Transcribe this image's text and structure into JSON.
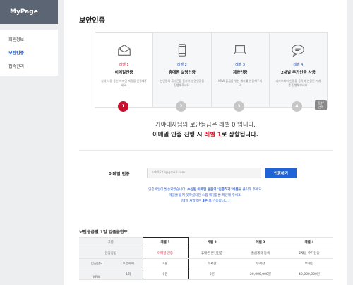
{
  "sidebar": {
    "title": "MyPage",
    "items": [
      {
        "label": "회원정보"
      },
      {
        "label": "보안인증"
      },
      {
        "label": "접속관리"
      }
    ]
  },
  "page": {
    "title": "보안인증"
  },
  "levels": [
    {
      "num": "레벨 1",
      "name": "이메일인증",
      "desc": "실제 사용 중인 이메일 계정을 인증해주세요.",
      "icon": "mail-icon"
    },
    {
      "num": "레벨 2",
      "name": "휴대폰 실명인증",
      "desc": "본인명의 휴대폰을 통하여 실명인증을 진행해주세요.",
      "icon": "phone-icon"
    },
    {
      "num": "레벨 3",
      "name": "계좌인증",
      "desc": "KRW 출금을 위한 계좌를 인증해주세요.",
      "icon": "laptop-icon"
    },
    {
      "num": "레벨 4",
      "name": "2채널 추가인증 사용",
      "desc": "카카오페이 인증을 통하여 인증된 거래를 진행해보세요.",
      "icon": "chat-icon",
      "badge": "필수/선택"
    }
  ],
  "steps": [
    "1",
    "2",
    "3",
    "4"
  ],
  "status": {
    "line1": "가야태자님의 보안등급은 레벨 0 입니다.",
    "line2_prefix": "이메일 인증 진행 시 ",
    "line2_level": "레벨 1",
    "line2_suffix": "로 상향됩니다."
  },
  "email": {
    "label": "이메일 인증",
    "value": "ssb0523@gmail.com",
    "button": "인증하기"
  },
  "notice": {
    "l1_a": "인증메일이 발송되었습니다. ",
    "l1_b": "수신된 이메일 본문의 '인증하기' 버튼",
    "l1_c": "을 클릭해 주세요.",
    "l2": "메일을 받지 못하셨다면 스팸 메일함을 확인해 주세요.",
    "l3_a": "(메일 재발송은 ",
    "l3_b": "3분 후",
    "l3_c": " 가능합니다.)"
  },
  "limits": {
    "title": "보안등급별 1일 입출금한도",
    "header": [
      "구분",
      "레벨 1",
      "레벨 2",
      "레벨 3",
      "레벨 4"
    ],
    "rows": [
      {
        "label": "인증방법",
        "values": [
          "이메일 인증",
          "휴대폰 본인인증",
          "출금계좌 등록",
          "2채널 추가인증"
        ]
      },
      {
        "group": "입금한도",
        "label": "모든화폐",
        "values": [
          "0원",
          "무제한",
          "무제한",
          "무제한"
        ]
      },
      {
        "group": "KRW",
        "label": "1회",
        "values": [
          "0원",
          "0원",
          "20,000,000원",
          "40,000,000원"
        ]
      }
    ]
  },
  "colors": {
    "accent": "#1f64d6",
    "highlight": "#d0162c",
    "sidebar_head": "#5b6573"
  }
}
